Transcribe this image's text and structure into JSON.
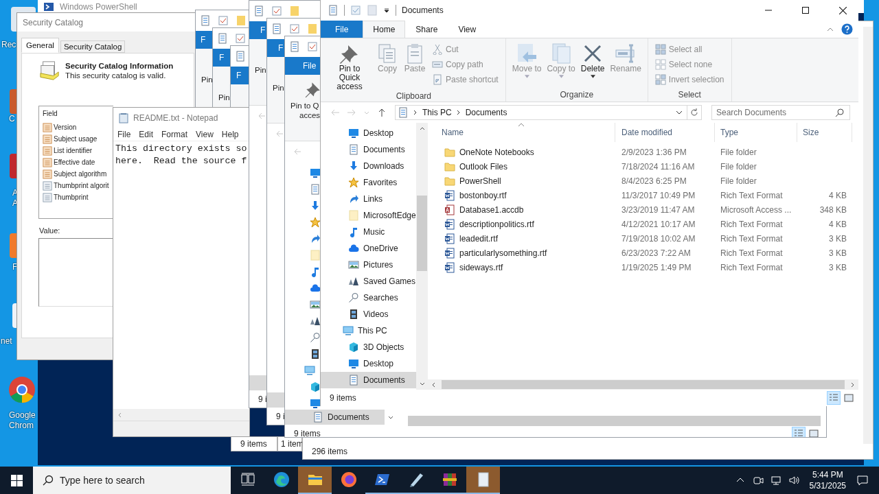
{
  "desktop_icons": [
    {
      "lines": [
        "Rec"
      ]
    },
    {
      "lines": [
        "C"
      ]
    },
    {
      "lines": [
        "A",
        "A"
      ]
    },
    {
      "lines": [
        "F"
      ]
    },
    {
      "lines": [
        "net"
      ]
    },
    {
      "lines": [
        "Google",
        "Chrom"
      ]
    }
  ],
  "powershell": {
    "title": "Windows PowerShell"
  },
  "security_catalog": {
    "title": "Security Catalog",
    "tabs": [
      {
        "label": "General",
        "selected": true
      },
      {
        "label": "Security Catalog",
        "selected": false
      }
    ],
    "heading": "Security Catalog Information",
    "subtitle": "This security catalog is valid.",
    "field_header": "Field",
    "fields": [
      "Version",
      "Subject usage",
      "List identifier",
      "Effective date",
      "Subject algorithm",
      "Thumbprint algorit",
      "Thumbprint"
    ],
    "value_label": "Value:"
  },
  "back_status_windows": [
    {
      "status": "9 items"
    },
    {
      "status": "1 item"
    },
    {
      "status": "296 items"
    }
  ],
  "notepad": {
    "title": "README.txt - Notepad",
    "menu": [
      "File",
      "Edit",
      "Format",
      "View",
      "Help"
    ],
    "lines": [
      "This directory exists so",
      "here.  Read the source f"
    ]
  },
  "background_windows": [
    {
      "file_tab": "F",
      "pin_lines": [
        "Pin"
      ]
    },
    {
      "file_tab": "F",
      "pin_lines": [
        "Pin"
      ]
    },
    {
      "file_tab": "F"
    },
    {
      "file_tab": "F",
      "pin_lines": [
        "Pin"
      ],
      "status": "9 i"
    },
    {
      "file_tab": "F",
      "pin_lines": [
        "Pin"
      ],
      "status": "9 i"
    },
    {
      "file_tab": "File",
      "pin_lines": [
        "Pin to Q",
        "acces"
      ],
      "nav_selected": "Documents",
      "status": "9 items"
    }
  ],
  "explorer": {
    "title": "Documents",
    "tabs": [
      {
        "label": "File",
        "kind": "file",
        "selected": false
      },
      {
        "label": "Home",
        "kind": "tab",
        "selected": true
      },
      {
        "label": "Share",
        "kind": "tab",
        "selected": false
      },
      {
        "label": "View",
        "kind": "tab",
        "selected": false
      }
    ],
    "groups": [
      {
        "label": "Clipboard",
        "large": [
          {
            "label": "Pin to Quick access",
            "disabled": false,
            "dropdown": false
          },
          {
            "label": "Copy",
            "disabled": true,
            "dropdown": false
          },
          {
            "label": "Paste",
            "disabled": true,
            "dropdown": false
          }
        ],
        "small": [
          {
            "label": "Cut",
            "disabled": true
          },
          {
            "label": "Copy path",
            "disabled": true
          },
          {
            "label": "Paste shortcut",
            "disabled": true
          }
        ]
      },
      {
        "label": "Organize",
        "large": [
          {
            "label": "Move to",
            "disabled": true,
            "dropdown": true
          },
          {
            "label": "Copy to",
            "disabled": true,
            "dropdown": true
          },
          {
            "label": "Delete",
            "disabled": false,
            "dropdown": true
          },
          {
            "label": "Rename",
            "disabled": true,
            "dropdown": false
          }
        ]
      },
      {
        "label": "Select",
        "small": [
          {
            "label": "Select all",
            "disabled": true
          },
          {
            "label": "Select none",
            "disabled": true
          },
          {
            "label": "Invert selection",
            "disabled": true
          }
        ]
      }
    ],
    "path": [
      "This PC",
      "Documents"
    ],
    "search_placeholder": "Search Documents",
    "nav": [
      {
        "label": "Desktop",
        "selected": false
      },
      {
        "label": "Documents",
        "selected": false
      },
      {
        "label": "Downloads",
        "selected": false
      },
      {
        "label": "Favorites",
        "selected": false
      },
      {
        "label": "Links",
        "selected": false
      },
      {
        "label": "MicrosoftEdge",
        "selected": false
      },
      {
        "label": "Music",
        "selected": false
      },
      {
        "label": "OneDrive",
        "selected": false
      },
      {
        "label": "Pictures",
        "selected": false
      },
      {
        "label": "Saved Games",
        "selected": false
      },
      {
        "label": "Searches",
        "selected": false
      },
      {
        "label": "Videos",
        "selected": false
      },
      {
        "label": "This PC",
        "selected": false,
        "children": [
          {
            "label": "3D Objects",
            "selected": false
          },
          {
            "label": "Desktop",
            "selected": false
          },
          {
            "label": "Documents",
            "selected": true
          }
        ]
      }
    ],
    "columns": [
      {
        "label": "Name",
        "sorted": true
      },
      {
        "label": "Date modified",
        "sorted": false
      },
      {
        "label": "Type",
        "sorted": false
      },
      {
        "label": "Size",
        "sorted": false
      }
    ],
    "rows": [
      {
        "kind": "folder",
        "name": "OneNote Notebooks",
        "date": "2/9/2023 1:36 PM",
        "type": "File folder",
        "size": ""
      },
      {
        "kind": "folder",
        "name": "Outlook Files",
        "date": "7/18/2024 11:16 AM",
        "type": "File folder",
        "size": ""
      },
      {
        "kind": "folder",
        "name": "PowerShell",
        "date": "8/4/2023 6:25 PM",
        "type": "File folder",
        "size": ""
      },
      {
        "kind": "rtf",
        "name": "bostonboy.rtf",
        "date": "11/3/2017 10:49 PM",
        "type": "Rich Text Format",
        "size": "4 KB"
      },
      {
        "kind": "accdb",
        "name": "Database1.accdb",
        "date": "3/23/2019 11:47 AM",
        "type": "Microsoft Access ...",
        "size": "348 KB"
      },
      {
        "kind": "rtf",
        "name": "descriptionpolitics.rtf",
        "date": "4/12/2021 10:17 AM",
        "type": "Rich Text Format",
        "size": "4 KB"
      },
      {
        "kind": "rtf",
        "name": "leadedit.rtf",
        "date": "7/19/2018 10:02 AM",
        "type": "Rich Text Format",
        "size": "3 KB"
      },
      {
        "kind": "rtf",
        "name": "particularlysomething.rtf",
        "date": "6/23/2023 7:22 AM",
        "type": "Rich Text Format",
        "size": "3 KB"
      },
      {
        "kind": "rtf",
        "name": "sideways.rtf",
        "date": "1/19/2025 1:49 PM",
        "type": "Rich Text Format",
        "size": "3 KB"
      }
    ],
    "status": "9 items",
    "views": [
      {
        "kind": "details",
        "selected": true
      },
      {
        "kind": "large",
        "selected": false
      }
    ]
  },
  "taskbar": {
    "search_placeholder": "Type here to search",
    "apps": [
      {
        "kind": "taskview",
        "running": false,
        "highlighted": false
      },
      {
        "kind": "edge",
        "running": false,
        "highlighted": false
      },
      {
        "kind": "explorer",
        "running": true,
        "highlighted": true
      },
      {
        "kind": "firefox",
        "running": false,
        "highlighted": false
      },
      {
        "kind": "powershell",
        "running": true,
        "highlighted": false
      },
      {
        "kind": "pen",
        "running": true,
        "highlighted": false
      },
      {
        "kind": "winrar",
        "running": true,
        "highlighted": false
      },
      {
        "kind": "notepad",
        "running": true,
        "highlighted": true
      }
    ],
    "time": "5:44 PM",
    "date": "5/31/2025"
  }
}
